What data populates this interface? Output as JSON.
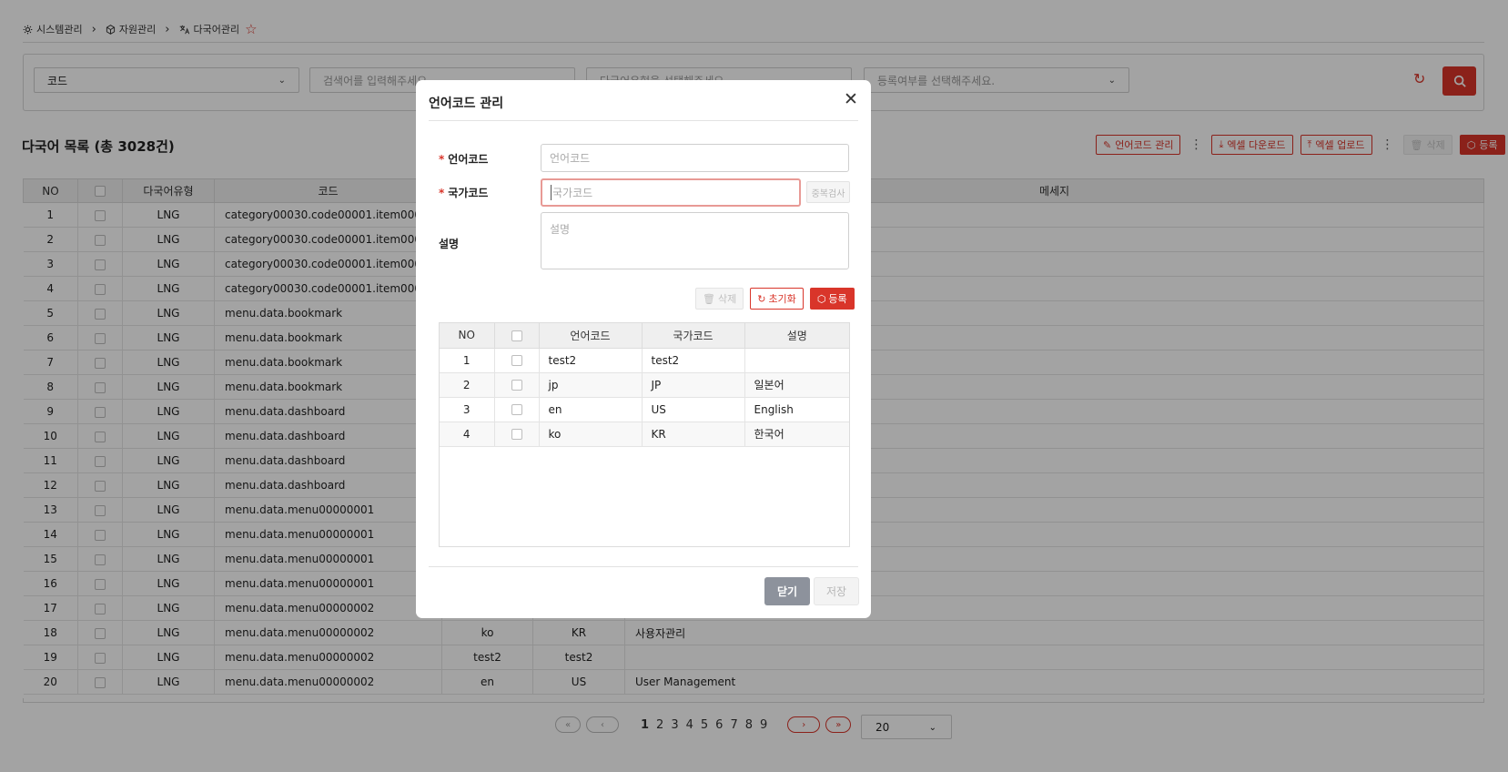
{
  "breadcrumb": {
    "items": [
      "시스템관리",
      "자원관리",
      "다국어관리"
    ]
  },
  "search": {
    "type_select": "코드",
    "keyword_placeholder": "검색어를 입력해주세요.",
    "lang_type_placeholder": "다국어유형을 선택해주세요.",
    "reg_placeholder": "등록여부를 선택해주세요."
  },
  "list": {
    "title": "다국어 목록 (총 3028건)",
    "toolbar": {
      "lang_code_manage": "언어코드 관리",
      "excel_download": "엑셀 다운로드",
      "excel_upload": "엑셀 업로드",
      "delete": "삭제",
      "register": "등록"
    },
    "columns": [
      "NO",
      "",
      "다국어유형",
      "코드",
      "",
      "",
      "메세지"
    ],
    "rows": [
      {
        "no": "1",
        "type": "LNG",
        "code": "category00030.code00001.item00001",
        "lang": "",
        "country": "",
        "message": ""
      },
      {
        "no": "2",
        "type": "LNG",
        "code": "category00030.code00001.item00001",
        "lang": "",
        "country": "",
        "message": ""
      },
      {
        "no": "3",
        "type": "LNG",
        "code": "category00030.code00001.item00001",
        "lang": "",
        "country": "",
        "message": ""
      },
      {
        "no": "4",
        "type": "LNG",
        "code": "category00030.code00001.item00001",
        "lang": "",
        "country": "",
        "message": ""
      },
      {
        "no": "5",
        "type": "LNG",
        "code": "menu.data.bookmark",
        "lang": "",
        "country": "",
        "message": ""
      },
      {
        "no": "6",
        "type": "LNG",
        "code": "menu.data.bookmark",
        "lang": "",
        "country": "",
        "message": ""
      },
      {
        "no": "7",
        "type": "LNG",
        "code": "menu.data.bookmark",
        "lang": "",
        "country": "",
        "message": ""
      },
      {
        "no": "8",
        "type": "LNG",
        "code": "menu.data.bookmark",
        "lang": "",
        "country": "",
        "message": ""
      },
      {
        "no": "9",
        "type": "LNG",
        "code": "menu.data.dashboard",
        "lang": "",
        "country": "",
        "message": ""
      },
      {
        "no": "10",
        "type": "LNG",
        "code": "menu.data.dashboard",
        "lang": "",
        "country": "",
        "message": ""
      },
      {
        "no": "11",
        "type": "LNG",
        "code": "menu.data.dashboard",
        "lang": "",
        "country": "",
        "message": ""
      },
      {
        "no": "12",
        "type": "LNG",
        "code": "menu.data.dashboard",
        "lang": "",
        "country": "",
        "message": ""
      },
      {
        "no": "13",
        "type": "LNG",
        "code": "menu.data.menu00000001",
        "lang": "",
        "country": "",
        "message": ""
      },
      {
        "no": "14",
        "type": "LNG",
        "code": "menu.data.menu00000001",
        "lang": "",
        "country": "",
        "message": ""
      },
      {
        "no": "15",
        "type": "LNG",
        "code": "menu.data.menu00000001",
        "lang": "",
        "country": "",
        "message": ""
      },
      {
        "no": "16",
        "type": "LNG",
        "code": "menu.data.menu00000001",
        "lang": "",
        "country": "",
        "message": ""
      },
      {
        "no": "17",
        "type": "LNG",
        "code": "menu.data.menu00000002",
        "lang": "",
        "country": "",
        "message": ""
      },
      {
        "no": "18",
        "type": "LNG",
        "code": "menu.data.menu00000002",
        "lang": "ko",
        "country": "KR",
        "message": "사용자관리"
      },
      {
        "no": "19",
        "type": "LNG",
        "code": "menu.data.menu00000002",
        "lang": "test2",
        "country": "test2",
        "message": ""
      },
      {
        "no": "20",
        "type": "LNG",
        "code": "menu.data.menu00000002",
        "lang": "en",
        "country": "US",
        "message": "User Management"
      }
    ]
  },
  "pagination": {
    "pages": [
      "1",
      "2",
      "3",
      "4",
      "5",
      "6",
      "7",
      "8",
      "9"
    ],
    "current": "1",
    "page_size": "20"
  },
  "modal": {
    "title": "언어코드 관리",
    "lang_code_label": "언어코드",
    "lang_code_placeholder": "언어코드",
    "country_code_label": "국가코드",
    "country_code_placeholder": "국가코드",
    "dup_check": "중복검사",
    "desc_label": "설명",
    "desc_placeholder": "설명",
    "delete": "삭제",
    "reset": "초기화",
    "register": "등록",
    "columns": [
      "NO",
      "",
      "언어코드",
      "국가코드",
      "설명"
    ],
    "rows": [
      {
        "no": "1",
        "lang": "test2",
        "country": "test2",
        "desc": ""
      },
      {
        "no": "2",
        "lang": "jp",
        "country": "JP",
        "desc": "일본어"
      },
      {
        "no": "3",
        "lang": "en",
        "country": "US",
        "desc": "English"
      },
      {
        "no": "4",
        "lang": "ko",
        "country": "KR",
        "desc": "한국어"
      }
    ],
    "close": "닫기",
    "save": "저장"
  },
  "colors": {
    "accent": "#d9352a",
    "overlay": "rgba(0,0,0,0.36)"
  }
}
